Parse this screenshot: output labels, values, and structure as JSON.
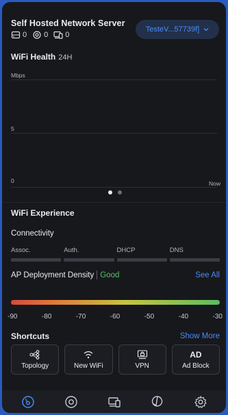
{
  "header": {
    "title": "Self Hosted Network Server",
    "stats": [
      {
        "icon": "gateway-icon",
        "value": "0"
      },
      {
        "icon": "access-point-icon",
        "value": "0"
      },
      {
        "icon": "client-devices-icon",
        "value": "0"
      }
    ],
    "site_selector": "TesteV...57739f]"
  },
  "wifi_health": {
    "title": "WiFi Health",
    "range": "24H",
    "unit": "Mbps",
    "y_ticks": [
      "5",
      "0"
    ],
    "x_label": "Now",
    "page_count": 2,
    "active_page": 1
  },
  "wifi_experience": {
    "title": "WiFi Experience",
    "connectivity": {
      "title": "Connectivity",
      "steps": [
        "Assoc.",
        "Auth.",
        "DHCP",
        "DNS"
      ]
    },
    "ap_density": {
      "label": "AP Deployment Density",
      "status": "Good",
      "link": "See All",
      "scale": [
        "-90",
        "-80",
        "-70",
        "-60",
        "-50",
        "-40",
        "-30"
      ]
    }
  },
  "shortcuts": {
    "title": "Shortcuts",
    "more": "Show More",
    "items": [
      {
        "label": "Topology",
        "icon": "topology-icon"
      },
      {
        "label": "New WiFi",
        "icon": "wifi-icon"
      },
      {
        "label": "VPN",
        "icon": "vpn-icon"
      },
      {
        "label": "Ad Block",
        "icon": "ad-block-icon",
        "glyph": "AD"
      }
    ]
  },
  "tabbar": {
    "tabs": [
      "dashboard-icon",
      "devices-icon",
      "clients-icon",
      "insights-icon",
      "settings-icon"
    ],
    "active_index": 0,
    "accent": "#4a8bf5"
  }
}
